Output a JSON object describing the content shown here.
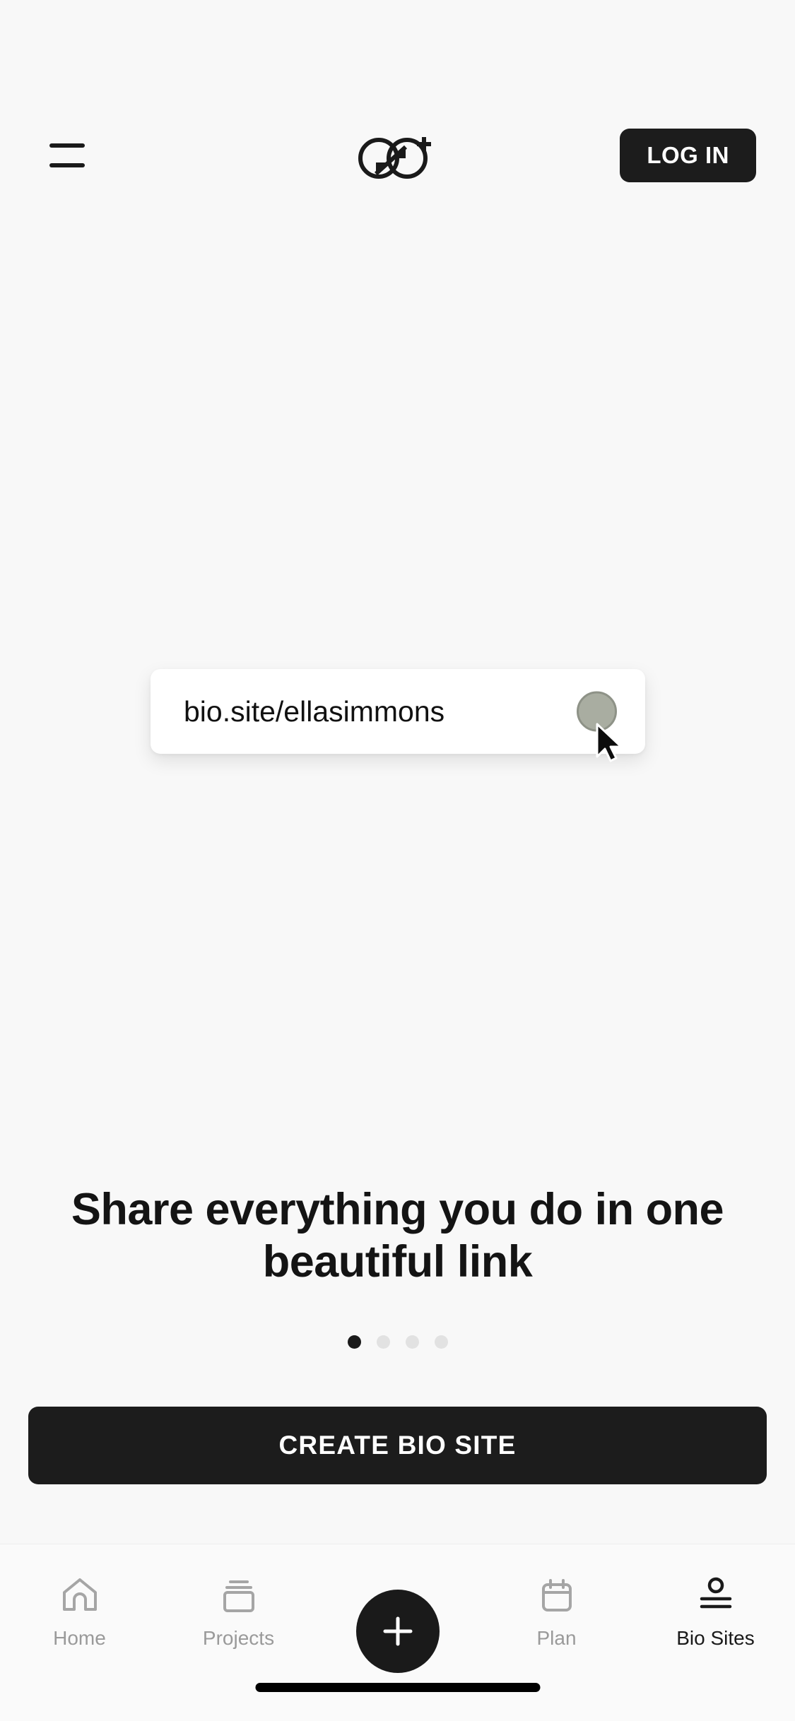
{
  "app": {
    "background_color": "#f8f8f8",
    "accent_color": "#1c1c1c"
  },
  "header": {
    "menu_icon": "hamburger-icon",
    "logo_icon": "hopp-logo-icon",
    "login_label": "LOG IN"
  },
  "hero": {
    "url_card": {
      "url_text": "bio.site/ellasimmons",
      "avatar_icon": "avatar-circle-icon",
      "avatar_color": "#a9ada1",
      "cursor_icon": "mouse-pointer-icon"
    },
    "headline": "Share everything you do in one beautiful link",
    "carousel": {
      "total_dots": 4,
      "active_index": 0,
      "active_color": "#1a1a1a",
      "inactive_color": "#e2e2e2"
    },
    "cta_label": "CREATE BIO SITE"
  },
  "bottom_nav": {
    "items": [
      {
        "label": "Home",
        "icon": "house-icon",
        "active": false
      },
      {
        "label": "Projects",
        "icon": "cards-stack-icon",
        "active": false
      },
      {
        "label": "",
        "icon": "plus-icon",
        "active": false
      },
      {
        "label": "Plan",
        "icon": "calendar-icon",
        "active": false
      },
      {
        "label": "Bio Sites",
        "icon": "bio-sites-icon",
        "active": true
      }
    ],
    "fab_icon": "plus-icon",
    "home_indicator": "home-indicator-bar"
  }
}
